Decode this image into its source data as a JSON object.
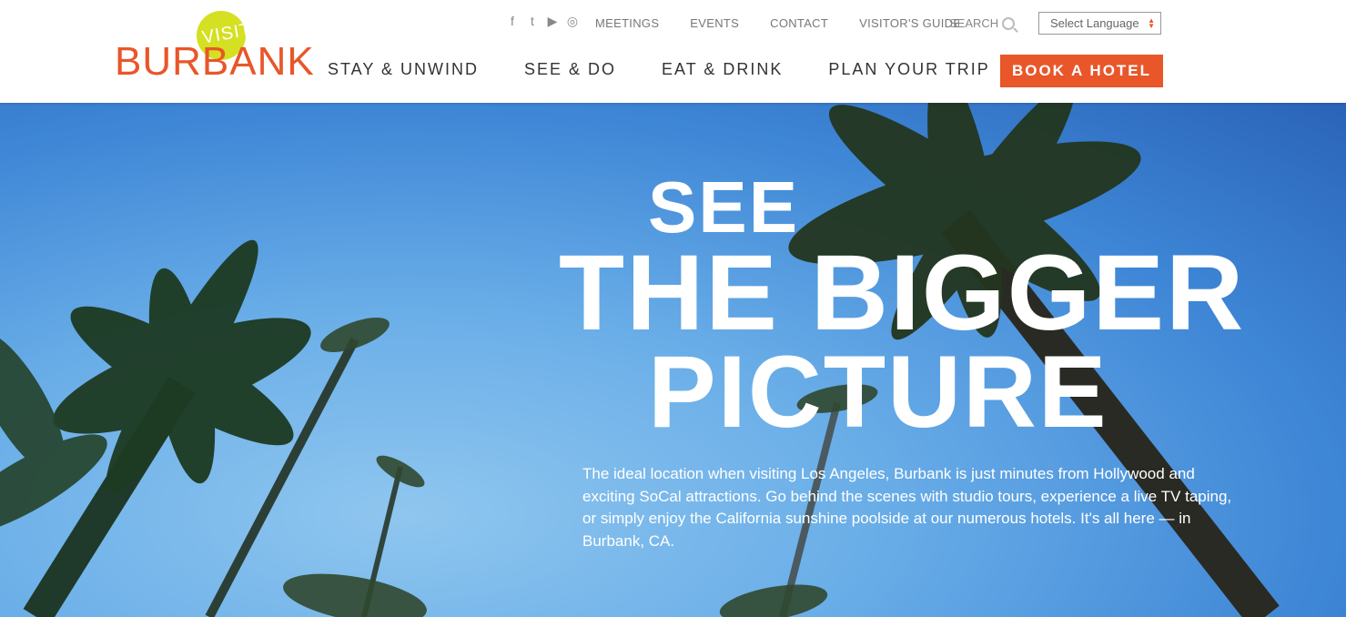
{
  "logo": {
    "visit": "VISIT",
    "name": "BURBANK"
  },
  "social": {
    "icons": [
      "facebook-icon",
      "twitter-icon",
      "youtube-icon",
      "instagram-icon"
    ],
    "glyphs": [
      "f",
      "t",
      "▶",
      "◎"
    ]
  },
  "utility_nav": [
    "MEETINGS",
    "EVENTS",
    "CONTACT",
    "VISITOR'S GUIDE"
  ],
  "search": {
    "label": "SEARCH"
  },
  "language": {
    "selected": "Select Language"
  },
  "main_nav": [
    "STAY & UNWIND",
    "SEE & DO",
    "EAT & DRINK",
    "PLAN YOUR TRIP"
  ],
  "book_button": "BOOK A HOTEL",
  "hero": {
    "line1": "SEE",
    "line2": "THE BIGGER",
    "line3": "PICTURE",
    "description": "The ideal location when visiting Los Angeles, Burbank is just minutes from Hollywood and exciting SoCal attractions. Go behind the scenes with studio tours, experience a live TV taping, or simply enjoy the California sunshine poolside at our numerous hotels. It's all here — in Burbank, CA."
  },
  "colors": {
    "accent": "#e8562a",
    "logo_circle": "#d4e021",
    "sky": "#5ea2e3"
  }
}
